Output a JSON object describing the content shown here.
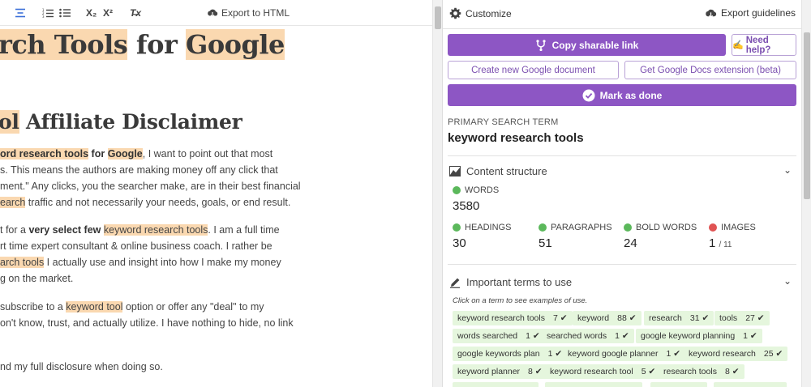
{
  "toolbar": {
    "align_icon": "align-center-icon",
    "ordered_list_icon": "ordered-list-icon",
    "bullet_list_icon": "bullet-list-icon",
    "subscript_label": "X₂",
    "superscript_label": "X²",
    "clear_format_label": "T̶x",
    "export_label": "Export to HTML"
  },
  "doc": {
    "h1_a": "rch Tools",
    "h1_b": " for ",
    "h1_c": "Google",
    "h2_a": "ol",
    "h2_b": " Affiliate Disclaimer",
    "p1_l1_a": "ord research tools",
    "p1_l1_b": " for ",
    "p1_l1_c": "Google",
    "p1_l1_d": ", I want to point out that most",
    "p1_l2": "s. This means the authors are making money off any click that",
    "p1_l3": "ment.\" Any clicks, you the searcher make, are in their best financial",
    "p1_l4_a": "earch",
    "p1_l4_b": " traffic and not necessarily your needs, goals, or end result.",
    "p2_l1_a": "t for a ",
    "p2_l1_b": "very select few",
    "p2_l1_c": " ",
    "p2_l1_d": "keyword research tools",
    "p2_l1_e": ". I am a full time",
    "p2_l2": "rt time expert consultant & online business coach. I rather be",
    "p2_l3_a": "arch tools",
    "p2_l3_b": " I actually use and insight into how I make my money",
    "p2_l4": "g on the market.",
    "p3_l1_a": "subscribe to a ",
    "p3_l1_b": "keyword tool",
    "p3_l1_c": " option or offer any \"deal\" to my",
    "p3_l2": "on't know, trust, and actually utilize. I have nothing to hide, no link",
    "p4_l1": "nd my full disclosure when doing so."
  },
  "panel": {
    "customize_label": "Customize",
    "export_guidelines_label": "Export guidelines",
    "copy_link_label": "Copy sharable link",
    "need_help_label": "Need help?",
    "create_doc_label": "Create new Google document",
    "get_ext_label": "Get Google Docs extension (beta)",
    "mark_done_label": "Mark as done",
    "primary_term_label": "PRIMARY SEARCH TERM",
    "primary_term_value": "keyword research tools",
    "content_structure_title": "Content structure",
    "words_label": "WORDS",
    "words_value": "3580",
    "headings_label": "HEADINGS",
    "headings_value": "30",
    "paragraphs_label": "PARAGRAPHS",
    "paragraphs_value": "51",
    "bold_label": "BOLD WORDS",
    "bold_value": "24",
    "images_label": "IMAGES",
    "images_value": "1",
    "images_target": "/ 11",
    "important_terms_title": "Important terms to use",
    "terms_hint": "Click on a term to see examples of use.",
    "terms": [
      {
        "term": "keyword research tools",
        "count": "7 ✔"
      },
      {
        "term": "keyword",
        "count": "88 ✔"
      },
      {
        "term": "research",
        "count": "31 ✔"
      },
      {
        "term": "tools",
        "count": "27 ✔"
      },
      {
        "term": "words searched",
        "count": "1 ✔"
      },
      {
        "term": "searched words",
        "count": "1 ✔"
      },
      {
        "term": "google keyword planning",
        "count": "1 ✔"
      },
      {
        "term": "google keywords plan",
        "count": "1 ✔"
      },
      {
        "term": "keyword google planner",
        "count": "1 ✔"
      },
      {
        "term": "keyword research",
        "count": "25 ✔"
      },
      {
        "term": "keyword planner",
        "count": "8 ✔"
      },
      {
        "term": "keyword research tool",
        "count": "5 ✔"
      },
      {
        "term": "research tools",
        "count": "8 ✔"
      }
    ]
  },
  "colors": {
    "accent": "#8d56c4",
    "highlight": "#fad8b0",
    "term_bg": "#e5f6dd",
    "ok": "#5bb85b",
    "bad": "#e05353"
  }
}
